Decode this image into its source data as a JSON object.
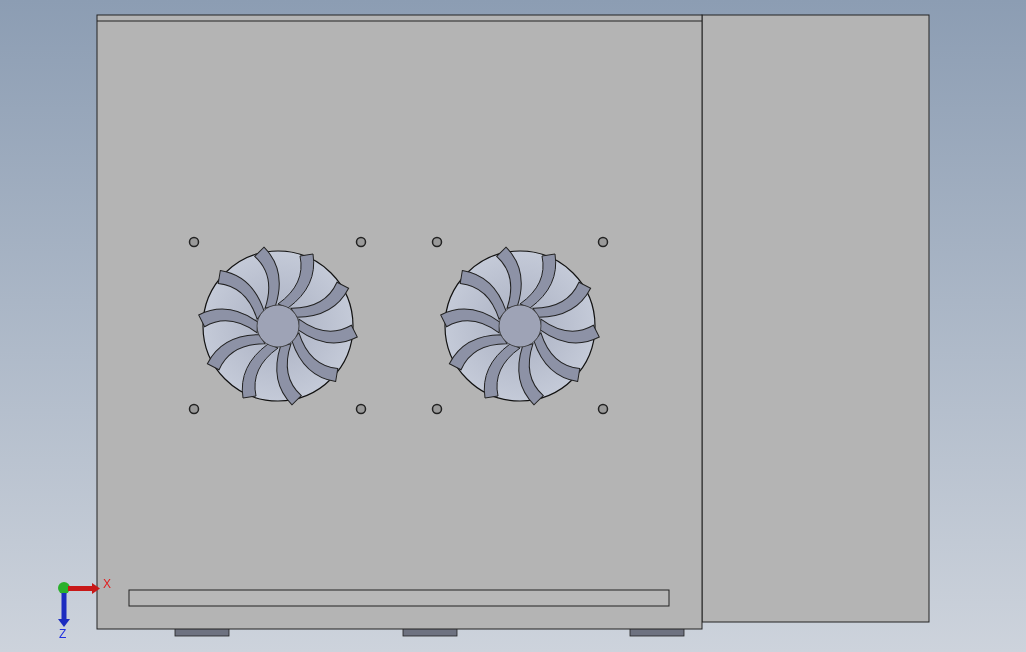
{
  "triad": {
    "axes": [
      {
        "label": "X",
        "kind": "x"
      },
      {
        "label": "Z",
        "kind": "z"
      }
    ]
  }
}
